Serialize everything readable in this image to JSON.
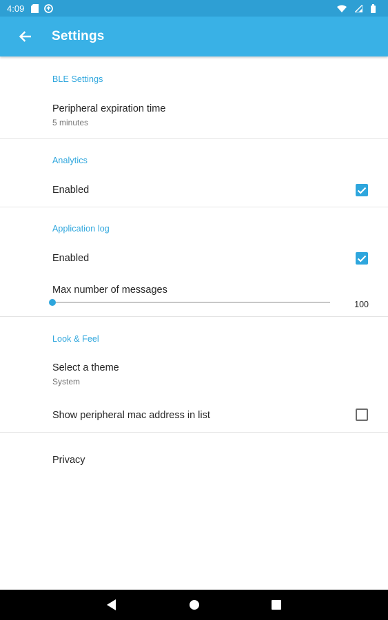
{
  "status_bar": {
    "time": "4:09",
    "left_icons": [
      "sd-card-icon",
      "sync-icon"
    ],
    "right_icons": [
      "wifi-icon",
      "signal-icon",
      "battery-icon"
    ]
  },
  "app_bar": {
    "title": "Settings",
    "color": "#39b1e6"
  },
  "accent_color": "#2ea6dd",
  "sections": {
    "ble": {
      "header": "BLE Settings",
      "expiration": {
        "title": "Peripheral expiration time",
        "summary": "5 minutes"
      }
    },
    "analytics": {
      "header": "Analytics",
      "enabled": {
        "title": "Enabled",
        "checked": true
      }
    },
    "app_log": {
      "header": "Application log",
      "enabled": {
        "title": "Enabled",
        "checked": true
      },
      "max_messages": {
        "title": "Max number of messages",
        "value": "100"
      }
    },
    "look_feel": {
      "header": "Look & Feel",
      "theme": {
        "title": "Select a theme",
        "summary": "System"
      },
      "show_mac": {
        "title": "Show peripheral mac address in list",
        "checked": false
      }
    },
    "privacy": {
      "title": "Privacy"
    }
  },
  "nav_bar": {
    "buttons": [
      "back-triangle-icon",
      "home-circle-icon",
      "recents-square-icon"
    ]
  }
}
